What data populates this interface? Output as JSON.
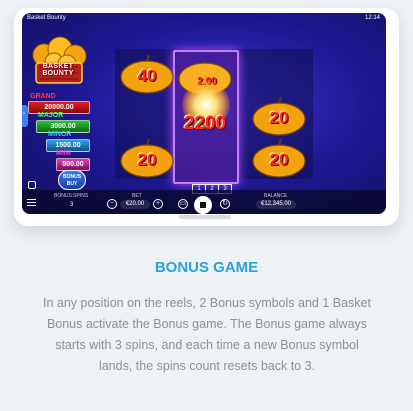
{
  "game": {
    "name": "Basket Bounty",
    "clock": "12:14",
    "logo_text": "BASKET BOUNTY",
    "jackpots": [
      {
        "label": "GRAND",
        "value": "20000.00",
        "color": "#e02020"
      },
      {
        "label": "MAJOR",
        "value": "3000.00",
        "color": "#2ac03a"
      },
      {
        "label": "MINOR",
        "value": "1500.00",
        "color": "#29a6e8"
      },
      {
        "label": "MINI",
        "value": "500.00",
        "color": "#e040b0"
      }
    ],
    "bonus_buy": "BONUS BUY",
    "reel_values": {
      "r1_c1": "40",
      "r1_c2": "2.00",
      "r2_c2": "2200",
      "r2_c3": "20",
      "r3_c1": "20",
      "r3_c3": "20"
    },
    "spin_slots": [
      "1",
      "2",
      "3"
    ],
    "bottom": {
      "bonus_spins_label": "BONUS SPINS",
      "bonus_spins_value": "3",
      "bet_label": "BET",
      "bet_value": "€20.00",
      "balance_label": "BALANCE",
      "balance_value": "€12,345.00"
    }
  },
  "section": {
    "title": "BONUS GAME",
    "description": "In any position on the reels, 2 Bonus symbols and 1 Basket Bonus activate the Bonus game. The Bonus game always starts with 3 spins, and each time a new Bonus symbol lands, the spins count resets back to 3."
  }
}
